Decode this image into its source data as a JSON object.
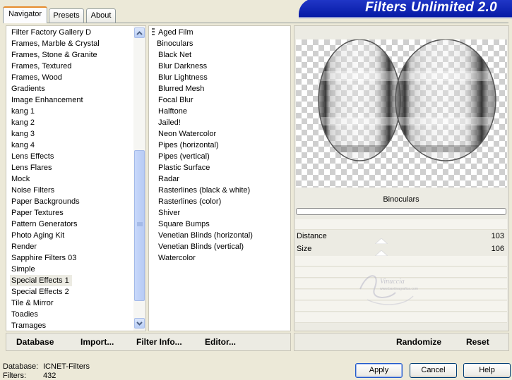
{
  "tabs": [
    {
      "label": "Navigator",
      "active": true
    },
    {
      "label": "Presets",
      "active": false
    },
    {
      "label": "About",
      "active": false
    }
  ],
  "app_title": "Filters Unlimited 2.0",
  "categories": {
    "items": [
      "Filter Factory Gallery D",
      "Frames, Marble & Crystal",
      "Frames, Stone & Granite",
      "Frames, Textured",
      "Frames, Wood",
      "Gradients",
      "Image Enhancement",
      "kang 1",
      "kang 2",
      "kang 3",
      "kang 4",
      "Lens Effects",
      "Lens Flares",
      "Mock",
      "Noise Filters",
      "Paper Backgrounds",
      "Paper Textures",
      "Pattern Generators",
      "Photo Aging Kit",
      "Render",
      "Sapphire Filters 03",
      "Simple",
      "Special Effects 1",
      "Special Effects 2",
      "Tile & Mirror",
      "Toadies",
      "Tramages"
    ],
    "selected": "Special Effects 1"
  },
  "filters": {
    "items": [
      "Aged Film",
      "Binoculars",
      "Black Net",
      "Blur Darkness",
      "Blur Lightness",
      "Blurred Mesh",
      "Focal Blur",
      "Halftone",
      "Jailed!",
      "Neon Watercolor",
      "Pipes (horizontal)",
      "Pipes (vertical)",
      "Plastic Surface",
      "Radar",
      "Rasterlines (black & white)",
      "Rasterlines (color)",
      "Shiver",
      "Square Bumps",
      "Venetian Blinds (horizontal)",
      "Venetian Blinds (vertical)",
      "Watercolor"
    ],
    "selected": "Binoculars"
  },
  "preview": {
    "filter_name": "Binoculars"
  },
  "params": [
    {
      "label": "Distance",
      "value": "103"
    },
    {
      "label": "Size",
      "value": "106"
    }
  ],
  "watermark": {
    "name": "Vinuccia",
    "url": "www.bavitnagrafica.com"
  },
  "bottom_links": {
    "database": "Database",
    "import": "Import...",
    "filter_info": "Filter Info...",
    "editor": "Editor...",
    "randomize": "Randomize",
    "reset": "Reset"
  },
  "status": {
    "database_label": "Database:",
    "database_value": "ICNET-Filters",
    "filters_label": "Filters:",
    "filters_value": "432"
  },
  "dialog_buttons": {
    "apply": "Apply",
    "cancel": "Cancel",
    "help": "Help"
  }
}
